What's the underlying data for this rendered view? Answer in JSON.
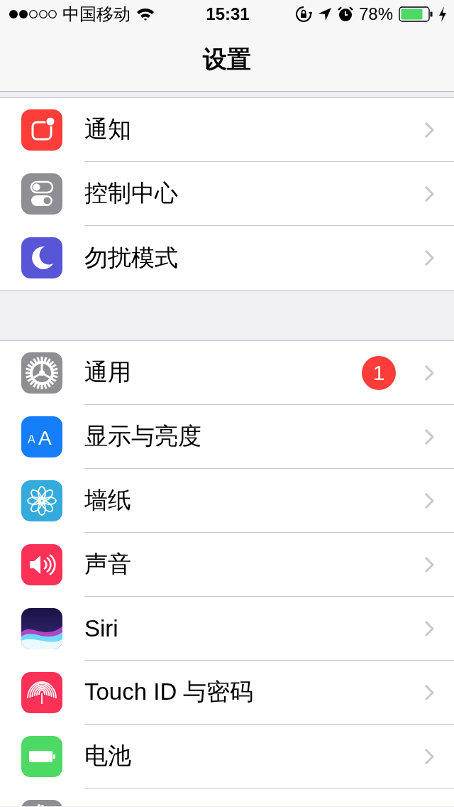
{
  "status_bar": {
    "carrier": "中国移动",
    "time": "15:31",
    "battery_percent": "78%"
  },
  "nav_bar": {
    "title": "设置"
  },
  "groups": [
    {
      "rows": [
        {
          "kind": "notifications",
          "label": "通知"
        },
        {
          "kind": "control",
          "label": "控制中心"
        },
        {
          "kind": "moon",
          "label": "勿扰模式"
        }
      ]
    },
    {
      "rows": [
        {
          "kind": "general",
          "label": "通用",
          "badge": "1"
        },
        {
          "kind": "display",
          "icon_text": "AA",
          "label": "显示与亮度"
        },
        {
          "kind": "wallpaper",
          "label": "墙纸"
        },
        {
          "kind": "sounds",
          "label": "声音"
        },
        {
          "kind": "siri",
          "label": "Siri"
        },
        {
          "kind": "fingerprint",
          "label": "Touch ID 与密码"
        },
        {
          "kind": "battery",
          "label": "电池"
        },
        {
          "kind": "privacy"
        }
      ]
    }
  ]
}
